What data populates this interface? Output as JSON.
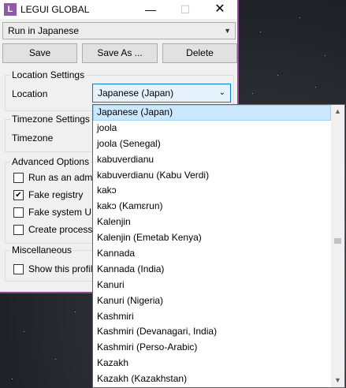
{
  "window": {
    "title": "LEGUI GLOBAL",
    "icon_letter": "L",
    "minimize_glyph": "—",
    "maximize_glyph": "☐",
    "close_glyph": "✕"
  },
  "profile": {
    "selected": "Run in Japanese"
  },
  "toolbar": {
    "save_label": "Save",
    "save_as_label": "Save As ...",
    "delete_label": "Delete"
  },
  "location_settings": {
    "title": "Location Settings",
    "location_label": "Location",
    "location_value": "Japanese (Japan)"
  },
  "timezone_settings": {
    "title": "Timezone Settings",
    "timezone_label": "Timezone"
  },
  "advanced_options": {
    "title": "Advanced Options",
    "items": [
      {
        "label": "Run as an admi",
        "checked": false
      },
      {
        "label": "Fake registry",
        "checked": true
      },
      {
        "label": "Fake system UI",
        "checked": false
      },
      {
        "label": "Create process",
        "checked": false
      }
    ]
  },
  "miscellaneous": {
    "title": "Miscellaneous",
    "items": [
      {
        "label": "Show this profil",
        "checked": false
      }
    ]
  },
  "dropdown": {
    "items": [
      "Japanese (Japan)",
      "joola",
      "joola (Senegal)",
      "kabuverdianu",
      "kabuverdianu (Kabu Verdi)",
      "kakɔ",
      "kakɔ (Kamɛrun)",
      "Kalenjin",
      "Kalenjin (Emetab Kenya)",
      "Kannada",
      "Kannada (India)",
      "Kanuri",
      "Kanuri (Nigeria)",
      "Kashmiri",
      "Kashmiri (Devanagari, India)",
      "Kashmiri (Perso-Arabic)",
      "Kazakh",
      "Kazakh (Kazakhstan)"
    ],
    "selected_index": 0,
    "scroll_position": 0.48
  },
  "colors": {
    "accent_border": "#8e4a98",
    "selection_bg": "#cce8ff",
    "focus_border": "#0078d7"
  },
  "icons": {
    "chevron": "chevron-down-icon",
    "checkmark": "checkmark-icon",
    "scroll_up": "scroll-up-icon",
    "scroll_down": "scroll-down-icon"
  }
}
